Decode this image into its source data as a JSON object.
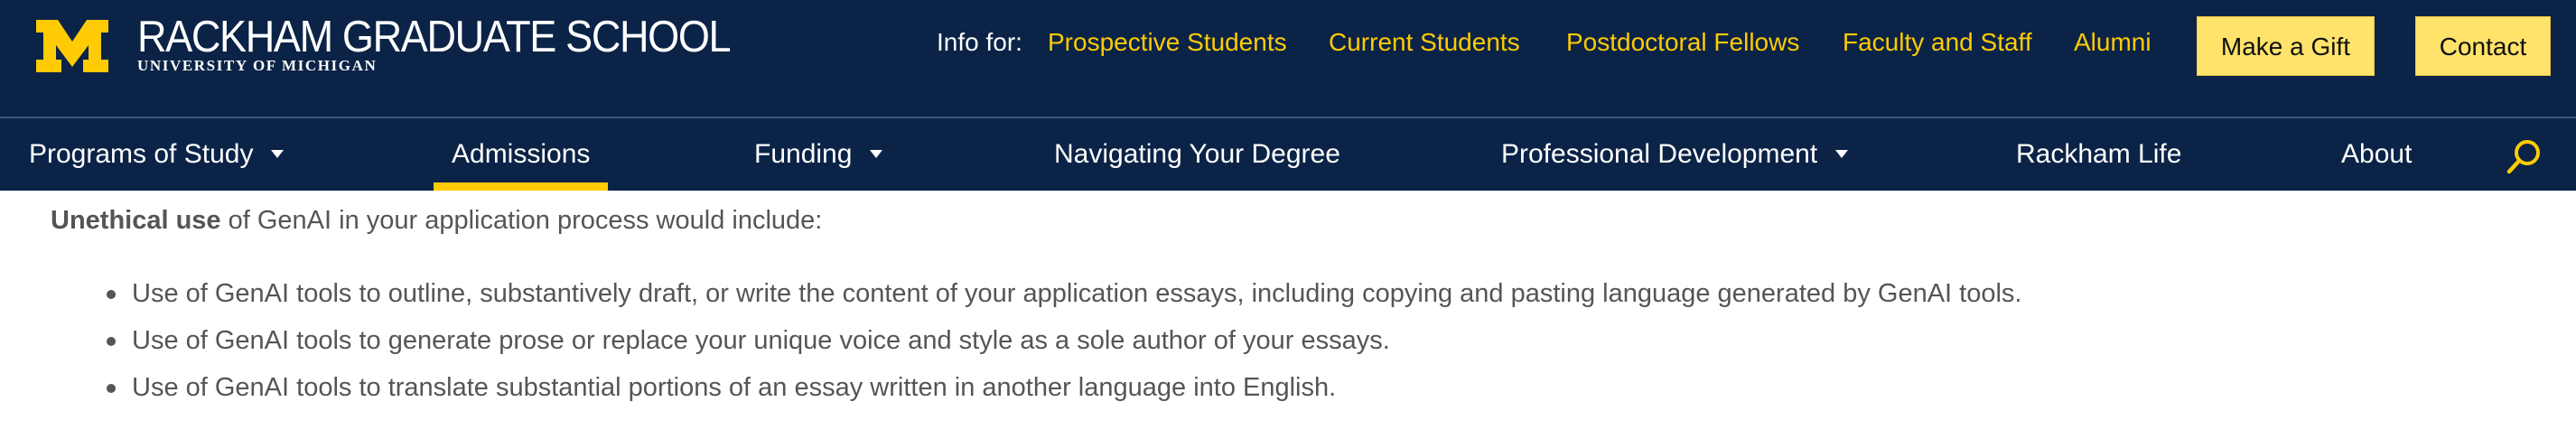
{
  "header": {
    "brand_name": "RACKHAM GRADUATE SCHOOL",
    "brand_sub": "UNIVERSITY OF MICHIGAN",
    "info_label": "Info for:",
    "audiences": [
      "Prospective Students",
      "Current Students",
      "Postdoctoral Fellows",
      "Faculty and Staff",
      "Alumni"
    ],
    "gift_label": "Make a Gift",
    "contact_label": "Contact"
  },
  "nav": {
    "items": [
      {
        "label": "Programs of Study",
        "has_dropdown": true
      },
      {
        "label": "Admissions",
        "active": true
      },
      {
        "label": "Funding",
        "has_dropdown": true
      },
      {
        "label": "Navigating Your Degree"
      },
      {
        "label": "Professional Development",
        "has_dropdown": true
      },
      {
        "label": "Rackham Life"
      },
      {
        "label": "About"
      }
    ],
    "search_icon": "search-icon"
  },
  "content": {
    "intro_bold": "Unethical use",
    "intro_rest": " of GenAI in your application process would include:",
    "bullets": [
      "Use of GenAI tools to outline, substantively draft, or write the content of your application essays, including copying and pasting language generated by GenAI tools.",
      "Use of GenAI tools to generate prose or replace your unique voice and style as a sole author of your essays.",
      "Use of GenAI tools to translate substantial portions of an essay written in another language into English."
    ]
  },
  "colors": {
    "navy": "#0b2346",
    "maize": "#ffcb05",
    "button_fill": "#ffe36a",
    "body_text": "#555555"
  }
}
